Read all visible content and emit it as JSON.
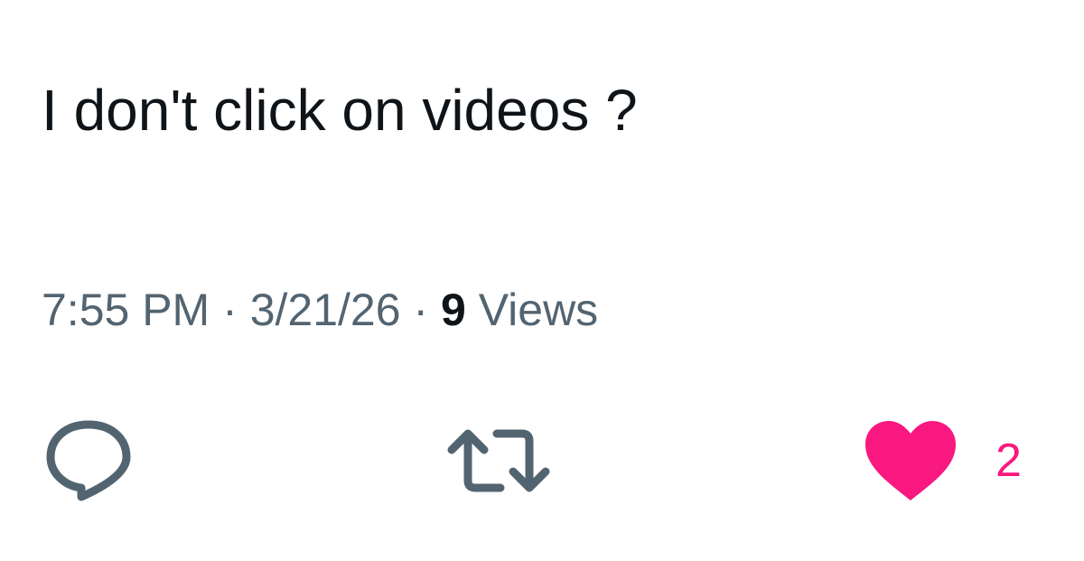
{
  "tweet": {
    "text": "I don't click on videos ?",
    "time": "7:55 PM",
    "separator": "·",
    "date": "3/21/26",
    "views_count": "9",
    "views_label": "Views"
  },
  "actions": {
    "like_count": "2"
  },
  "icons": {
    "reply": "reply-icon",
    "repost": "repost-icon",
    "like": "heart-icon"
  },
  "colors": {
    "text": "#0f1419",
    "muted": "#536471",
    "like": "#f91880"
  }
}
